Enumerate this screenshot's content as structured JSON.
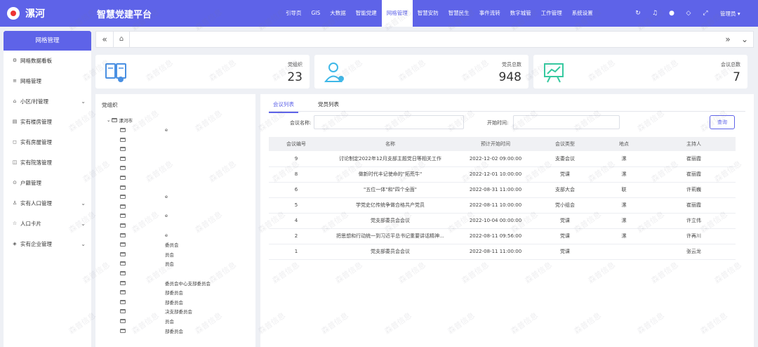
{
  "header": {
    "city": "漯河",
    "platform": "智慧党建平台",
    "nav": [
      "引导页",
      "GIS",
      "大数据",
      "智能党建",
      "网格管理",
      "智慧安防",
      "智慧民生",
      "事件流转",
      "数字城管",
      "工作管理",
      "系统设置"
    ],
    "active_nav": "网格管理",
    "icons": [
      "refresh-icon",
      "bell-icon",
      "message-icon",
      "tag-icon",
      "fullscreen-icon"
    ],
    "user": "管理员 ▾"
  },
  "sidebar": {
    "title": "网格管理",
    "items": [
      {
        "label": "网格数据看板",
        "icon": "⚙",
        "chevron": false
      },
      {
        "label": "网格管理",
        "icon": "≡",
        "chevron": false
      },
      {
        "label": "小区/村管理",
        "icon": "⌂",
        "chevron": true
      },
      {
        "label": "实有楼房管理",
        "icon": "▤",
        "chevron": false
      },
      {
        "label": "实有房屋管理",
        "icon": "◻",
        "chevron": false
      },
      {
        "label": "实有院落管理",
        "icon": "◫",
        "chevron": false
      },
      {
        "label": "户籍管理",
        "icon": "⊙",
        "chevron": false
      },
      {
        "label": "实有人口管理",
        "icon": "♙",
        "chevron": true
      },
      {
        "label": "人口卡片",
        "icon": "☆",
        "chevron": true
      },
      {
        "label": "实有企业管理",
        "icon": "◈",
        "chevron": true
      }
    ]
  },
  "tabsbar": {
    "left": "«",
    "home": "⌂",
    "right1": "»",
    "right2": "⌄"
  },
  "stats": [
    {
      "label": "党组织",
      "value": "23",
      "icon": "book-icon"
    },
    {
      "label": "党员总数",
      "value": "948",
      "icon": "person-icon"
    },
    {
      "label": "会议总数",
      "value": "7",
      "icon": "presentation-icon"
    }
  ],
  "tree": {
    "title": "党组织",
    "root": "漯河市",
    "nodes": [
      "e",
      "",
      "",
      "",
      "",
      "",
      "",
      "e",
      "",
      "e",
      "",
      "e",
      "委员会",
      "员会",
      "员会",
      "",
      "委员会中心支部委员会",
      "部委员会",
      "部委员会",
      "决支部委员会",
      "员会",
      "部委员会"
    ]
  },
  "meetings": {
    "tabs": [
      "会议列表",
      "党员列表"
    ],
    "active_tab": "会议列表",
    "filters": {
      "name_label": "会议名称:",
      "start_label": "开始时间:",
      "query_btn": "查询"
    },
    "columns": [
      "会议编号",
      "名称",
      "预计开始时间",
      "会议类型",
      "地点",
      "主持人"
    ],
    "rows": [
      [
        "9",
        "讨论制定2022年12月支部主题党日等相关工作",
        "2022-12-02 09:00:00",
        "支委会议",
        "漯",
        "崔丽霞"
      ],
      [
        "8",
        "做新时代丰记使命的\"拓荒牛\"",
        "2022-12-01 10:00:00",
        "党课",
        "漯",
        "崔丽霞"
      ],
      [
        "6",
        "\"五位一体\"和\"四个全面\"",
        "2022-08-31 11:00:00",
        "支部大会",
        "联",
        "许莉巍"
      ],
      [
        "5",
        "学党史亿传统争做合格共产党员",
        "2022-08-11 10:00:00",
        "党小组会",
        "漯",
        "崔丽霞"
      ],
      [
        "4",
        "党支部委员会会议",
        "2022-10-04 00:00:00",
        "党课",
        "漯",
        "许立伟"
      ],
      [
        "2",
        "把思想和行动统一到习近平总书记重要讲话精神...",
        "2022-08-11 09:56:00",
        "党课",
        "漯",
        "许再川"
      ],
      [
        "1",
        "党支部委员会会议",
        "2022-08-11 11:00:00",
        "党课",
        "",
        "张云龙"
      ]
    ]
  },
  "watermark": "森普信息"
}
